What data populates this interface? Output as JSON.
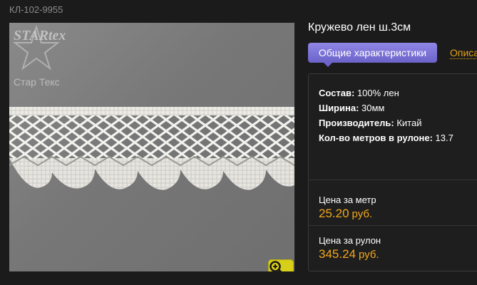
{
  "product": {
    "sku": "КЛ-102-9955",
    "title": "Кружево лен ш.3см",
    "watermark_brand": "STARtex",
    "watermark_sub": "Стар Текс"
  },
  "tabs": {
    "active": "Общие характеристики",
    "next": "Описа"
  },
  "specs": [
    {
      "label": "Состав:",
      "value": "100% лен"
    },
    {
      "label": "Ширина:",
      "value": "30мм"
    },
    {
      "label": "Производитель:",
      "value": "Китай"
    },
    {
      "label": "Кол-во метров в рулоне:",
      "value": "13.7"
    }
  ],
  "prices": {
    "meter_label": "Цена за метр",
    "meter_value": "25.20",
    "meter_currency": "руб.",
    "roll_label": "Цена за рулон",
    "roll_value": "345.24",
    "roll_currency": "руб."
  },
  "icons": {
    "zoom": "zoom-in-icon",
    "watermark": "star-logo-icon"
  },
  "colors": {
    "accent_tab": "#7a71d8",
    "price": "#f2a81a",
    "link": "#e4a319",
    "zoom_button": "#d8cf19"
  }
}
